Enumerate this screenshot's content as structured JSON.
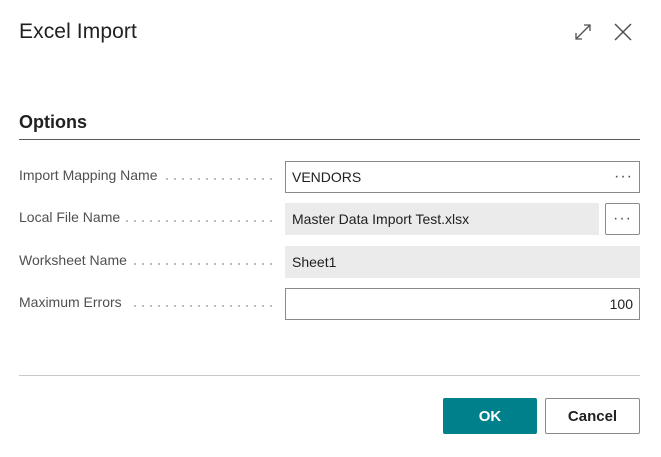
{
  "dialog": {
    "title": "Excel Import",
    "expand_icon": "expand-icon",
    "close_icon": "close-icon"
  },
  "options": {
    "section_title": "Options",
    "fields": [
      {
        "label": "Import Mapping Name",
        "value": "VENDORS",
        "editable": true,
        "assist": "ellipsis-icon"
      },
      {
        "label": "Local File Name",
        "value": "Master Data Import Test.xlsx",
        "editable": false,
        "assist_button": "ellipsis-icon"
      },
      {
        "label": "Worksheet Name",
        "value": "Sheet1",
        "editable": false
      },
      {
        "label": "Maximum Errors",
        "value": "100",
        "editable": true,
        "align": "right"
      }
    ]
  },
  "footer": {
    "ok_label": "OK",
    "cancel_label": "Cancel"
  },
  "colors": {
    "accent": "#00808a",
    "readonly_bg": "#ebebeb",
    "label_text": "#505050"
  }
}
